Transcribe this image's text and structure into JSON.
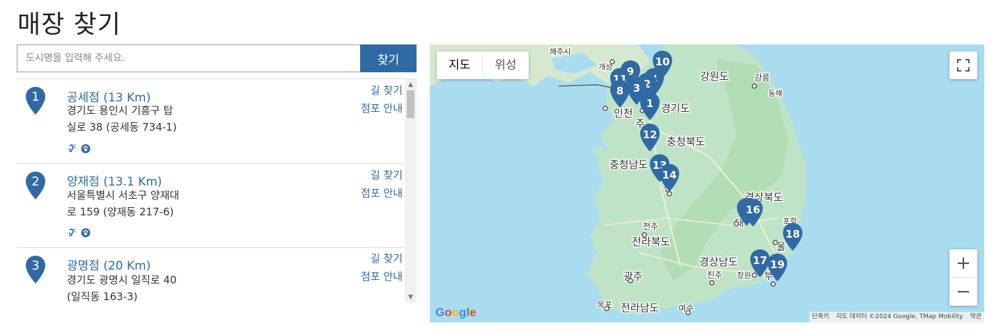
{
  "page": {
    "title": "매장 찾기"
  },
  "search": {
    "placeholder": "도시명을 입력해 주세요.",
    "button_label": "찾기"
  },
  "stores": [
    {
      "number": "1",
      "name": "공세점 (13 Km)",
      "addr1": "경기도 용인시 기흥구 탑",
      "addr2": "실로 38 (공세동 734-1)",
      "directions_label": "길 찾기",
      "info_label": "점포 안내",
      "amenities": [
        "accessibility-icon",
        "pet-icon"
      ]
    },
    {
      "number": "2",
      "name": "양재점 (13.1 Km)",
      "addr1": "서울특별시 서초구 양재대",
      "addr2": "로 159 (양재동 217-6)",
      "directions_label": "길 찾기",
      "info_label": "점포 안내",
      "amenities": [
        "accessibility-icon",
        "pet-icon"
      ]
    },
    {
      "number": "3",
      "name": "광명점 (20 Km)",
      "addr1": "경기도 광명시 일직로 40",
      "addr2": "(일직동 163-3)",
      "directions_label": "길 찾기",
      "info_label": "점포 안내",
      "amenities": []
    }
  ],
  "map": {
    "type_tabs": [
      "지도",
      "위성"
    ],
    "active_tab": "지도",
    "zoom_in_label": "+",
    "zoom_out_label": "−",
    "google_logo": "Google",
    "attribution": [
      "단축키",
      "지도 데이터 ©2024 Google, TMap Mobility",
      "약관"
    ],
    "place_labels": [
      "해주시",
      "개성",
      "강원도",
      "강릉",
      "동해",
      "인천",
      "경기도",
      "충청북도",
      "충청남도",
      "경상북도",
      "포항",
      "대",
      "전주",
      "전라북도",
      "울",
      "경상남도",
      "진주",
      "창원",
      "광주",
      "목포",
      "전라남도",
      "여수",
      "부",
      "주",
      "전"
    ],
    "marker_labels": [
      "1",
      "2",
      "3",
      "4",
      "8",
      "9",
      "10",
      "11",
      "12",
      "13",
      "14",
      "16",
      "17",
      "18",
      "19"
    ]
  },
  "colors": {
    "accent": "#2f6aa5",
    "marker": "#2f6aa5",
    "sea": "#aadcf0",
    "land": "#bfe3c6"
  }
}
